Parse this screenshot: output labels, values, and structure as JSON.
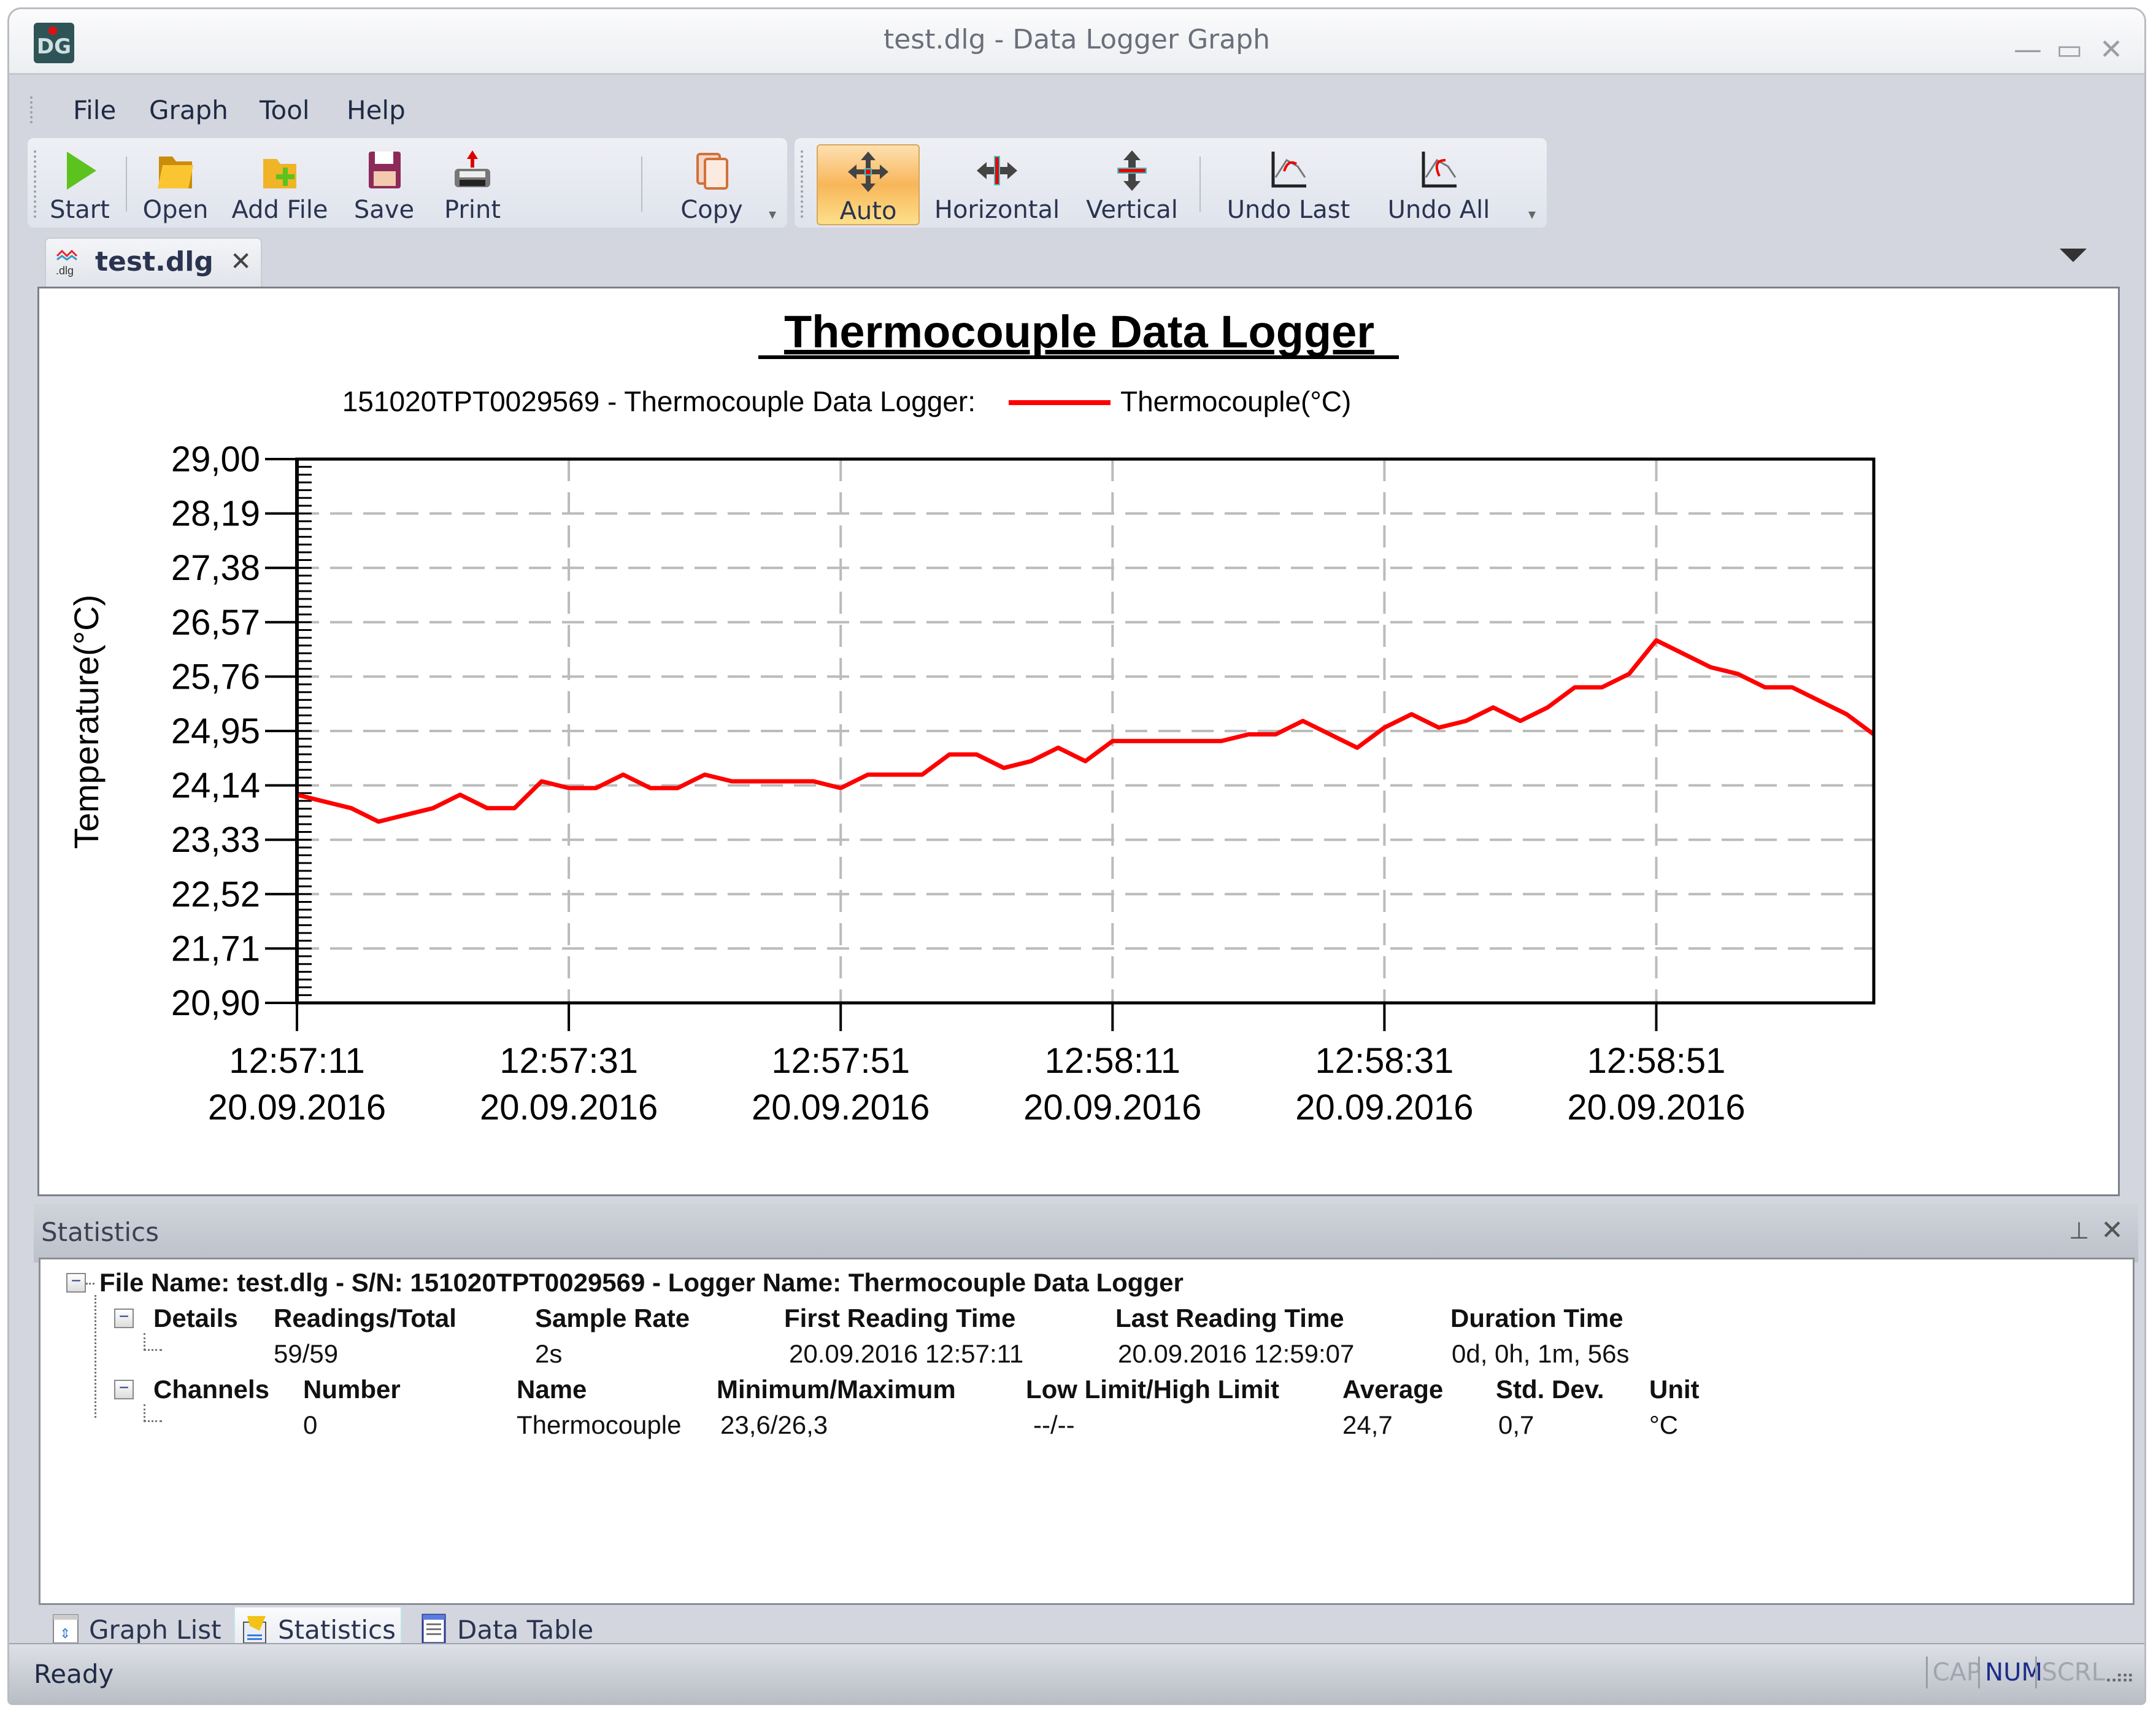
{
  "window": {
    "title": "test.dlg - Data Logger Graph",
    "logo_text": "DG",
    "controls": {
      "minimize": "—",
      "maximize": "▭",
      "close": "✕"
    }
  },
  "menu": [
    "File",
    "Graph",
    "Tool",
    "Help"
  ],
  "toolbar": {
    "file_group": [
      {
        "label": "Start",
        "icon": "play-icon"
      },
      {
        "label": "Open",
        "icon": "folder-open-icon"
      },
      {
        "label": "Add File",
        "icon": "folder-add-icon"
      },
      {
        "label": "Save",
        "icon": "floppy-disk-icon"
      },
      {
        "label": "Print",
        "icon": "printer-icon"
      },
      {
        "label": "Copy",
        "icon": "copy-icon"
      }
    ],
    "zoom_group": [
      {
        "label": "Auto",
        "icon": "move-all-icon",
        "active": true
      },
      {
        "label": "Horizontal",
        "icon": "move-horizontal-icon"
      },
      {
        "label": "Vertical",
        "icon": "move-vertical-icon"
      },
      {
        "label": "Undo Last",
        "icon": "undo-last-icon"
      },
      {
        "label": "Undo All",
        "icon": "undo-all-icon"
      }
    ]
  },
  "document_tab": {
    "name": "test.dlg",
    "icon_text": ".dlg",
    "close": "✕"
  },
  "chart_data": {
    "type": "line",
    "title": "Thermocouple Data Logger",
    "legend_prefix": "151020TPT0029569 - Thermocouple Data Logger:",
    "legend_position": "top-center",
    "ylabel": "Temperature(°C)",
    "xlabel": "",
    "ylim": [
      20.9,
      29.0
    ],
    "yticks": [
      "29,00",
      "28,19",
      "27,38",
      "26,57",
      "25,76",
      "24,95",
      "24,14",
      "23,33",
      "22,52",
      "21,71",
      "20,90"
    ],
    "xlim_seconds": [
      0,
      116
    ],
    "xticks": [
      {
        "t": 0,
        "time": "12:57:11",
        "date": "20.09.2016"
      },
      {
        "t": 20,
        "time": "12:57:31",
        "date": "20.09.2016"
      },
      {
        "t": 40,
        "time": "12:57:51",
        "date": "20.09.2016"
      },
      {
        "t": 60,
        "time": "12:58:11",
        "date": "20.09.2016"
      },
      {
        "t": 80,
        "time": "12:58:31",
        "date": "20.09.2016"
      },
      {
        "t": 100,
        "time": "12:58:51",
        "date": "20.09.2016"
      }
    ],
    "grid": true,
    "series": [
      {
        "name": "Thermocouple(°C)",
        "color": "#ff0000",
        "sample_interval_s": 2,
        "values": [
          24.0,
          23.9,
          23.8,
          23.6,
          23.7,
          23.8,
          24.0,
          23.8,
          23.8,
          24.2,
          24.1,
          24.1,
          24.3,
          24.1,
          24.1,
          24.3,
          24.2,
          24.2,
          24.2,
          24.2,
          24.1,
          24.3,
          24.3,
          24.3,
          24.6,
          24.6,
          24.4,
          24.5,
          24.7,
          24.5,
          24.8,
          24.8,
          24.8,
          24.8,
          24.8,
          24.9,
          24.9,
          25.1,
          24.9,
          24.7,
          25.0,
          25.2,
          25.0,
          25.1,
          25.3,
          25.1,
          25.3,
          25.6,
          25.6,
          25.8,
          26.3,
          26.1,
          25.9,
          25.8,
          25.6,
          25.6,
          25.4,
          25.2,
          24.9
        ]
      }
    ]
  },
  "statistics": {
    "panel_title": "Statistics",
    "pin": "⊥",
    "close": "✕",
    "file_line": "File Name: test.dlg - S/N: 151020TPT0029569 - Logger Name: Thermocouple Data Logger",
    "details": {
      "label": "Details",
      "headers": [
        "Readings/Total",
        "Sample Rate",
        "First Reading Time",
        "Last Reading Time",
        "Duration Time"
      ],
      "values": [
        "59/59",
        "2s",
        "20.09.2016 12:57:11",
        "20.09.2016 12:59:07",
        "0d, 0h, 1m, 56s"
      ]
    },
    "channels": {
      "label": "Channels",
      "headers": [
        "Number",
        "Name",
        "Minimum/Maximum",
        "Low Limit/High Limit",
        "Average",
        "Std. Dev.",
        "Unit"
      ],
      "values": [
        "0",
        "Thermocouple",
        "23,6/26,3",
        "--/--",
        "24,7",
        "0,7",
        "°C"
      ]
    }
  },
  "bottom_tabs": [
    {
      "label": "Graph List",
      "icon": "graph-list-icon"
    },
    {
      "label": "Statistics",
      "icon": "statistics-icon",
      "active": true
    },
    {
      "label": "Data Table",
      "icon": "data-table-icon"
    }
  ],
  "status": {
    "text": "Ready",
    "indicators": [
      {
        "label": "CAP",
        "on": false
      },
      {
        "label": "NUM",
        "on": true
      },
      {
        "label": "SCRL",
        "on": false
      }
    ]
  }
}
